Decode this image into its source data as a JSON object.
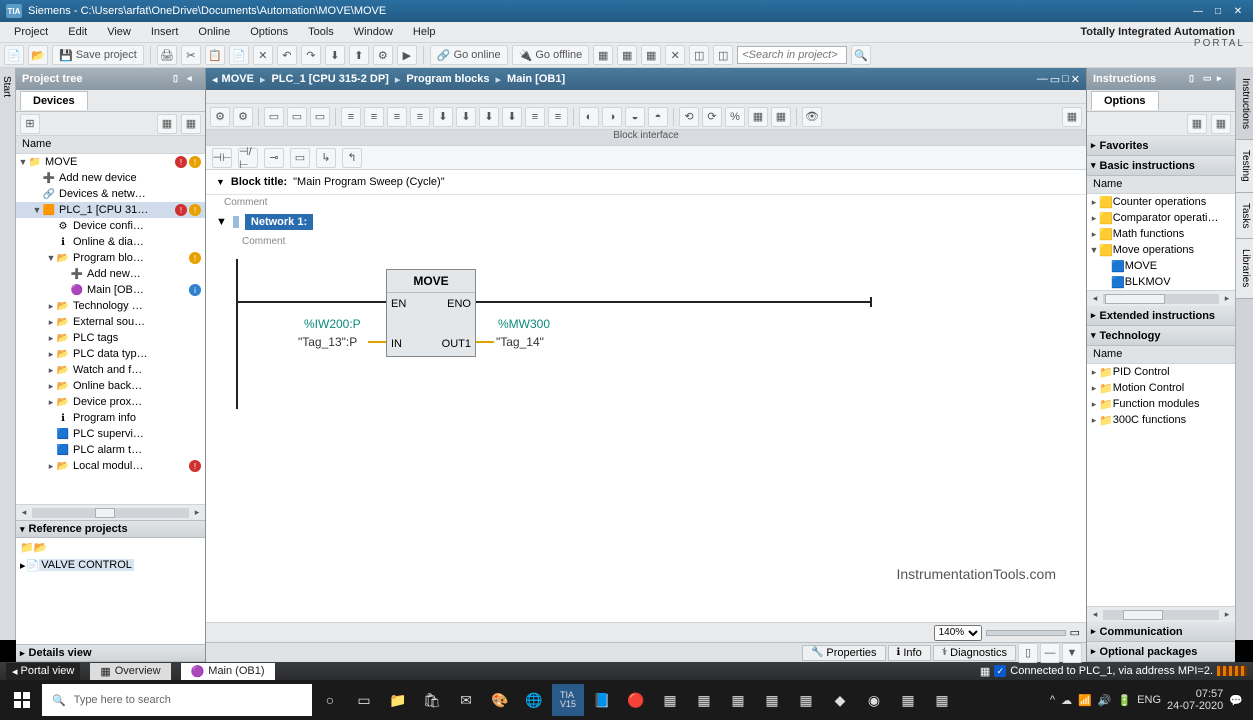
{
  "title": "Siemens  -  C:\\Users\\arfat\\OneDrive\\Documents\\Automation\\MOVE\\MOVE",
  "menu": [
    "Project",
    "Edit",
    "View",
    "Insert",
    "Online",
    "Options",
    "Tools",
    "Window",
    "Help"
  ],
  "brand": {
    "line1": "Totally Integrated Automation",
    "line2": "PORTAL"
  },
  "toolbar1": {
    "save": "Save project",
    "goonline": "Go online",
    "gooffline": "Go offline",
    "search_ph": "<Search in project>"
  },
  "projecttree": {
    "title": "Project tree",
    "tab": "Devices",
    "namehdr": "Name"
  },
  "tree": [
    {
      "ind": 0,
      "exp": "▼",
      "icon": "📁",
      "txt": "MOVE",
      "badges": [
        "err",
        "warn"
      ]
    },
    {
      "ind": 1,
      "exp": "",
      "icon": "➕",
      "txt": "Add new device"
    },
    {
      "ind": 1,
      "exp": "",
      "icon": "🔗",
      "txt": "Devices & netw…"
    },
    {
      "ind": 1,
      "exp": "▼",
      "icon": "🟧",
      "txt": "PLC_1 [CPU 31…",
      "sel": true,
      "badges": [
        "err",
        "warn"
      ]
    },
    {
      "ind": 2,
      "exp": "",
      "icon": "⚙",
      "txt": "Device confi…"
    },
    {
      "ind": 2,
      "exp": "",
      "icon": "ℹ",
      "txt": "Online & dia…"
    },
    {
      "ind": 2,
      "exp": "▼",
      "icon": "📂",
      "txt": "Program blo…",
      "badges": [
        "warn"
      ]
    },
    {
      "ind": 3,
      "exp": "",
      "icon": "➕",
      "txt": "Add new…"
    },
    {
      "ind": 3,
      "exp": "",
      "icon": "🟣",
      "txt": "Main [OB…",
      "badges": [
        "info"
      ]
    },
    {
      "ind": 2,
      "exp": "▸",
      "icon": "📂",
      "txt": "Technology …"
    },
    {
      "ind": 2,
      "exp": "▸",
      "icon": "📂",
      "txt": "External sou…"
    },
    {
      "ind": 2,
      "exp": "▸",
      "icon": "📂",
      "txt": "PLC tags"
    },
    {
      "ind": 2,
      "exp": "▸",
      "icon": "📂",
      "txt": "PLC data typ…"
    },
    {
      "ind": 2,
      "exp": "▸",
      "icon": "📂",
      "txt": "Watch and f…"
    },
    {
      "ind": 2,
      "exp": "▸",
      "icon": "📂",
      "txt": "Online back…"
    },
    {
      "ind": 2,
      "exp": "▸",
      "icon": "📂",
      "txt": "Device prox…"
    },
    {
      "ind": 2,
      "exp": "",
      "icon": "ℹ",
      "txt": "Program info"
    },
    {
      "ind": 2,
      "exp": "",
      "icon": "🟦",
      "txt": "PLC supervi…"
    },
    {
      "ind": 2,
      "exp": "",
      "icon": "🟦",
      "txt": "PLC alarm t…"
    },
    {
      "ind": 2,
      "exp": "▸",
      "icon": "📂",
      "txt": "Local modul…",
      "badges": [
        "err"
      ]
    }
  ],
  "refprojects": {
    "title": "Reference projects",
    "item": "VALVE CONTROL"
  },
  "detailsview": "Details view",
  "breadcrumb": [
    "MOVE",
    "PLC_1 [CPU 315-2 DP]",
    "Program blocks",
    "Main [OB1]"
  ],
  "blockinterface": "Block interface",
  "blocktitle": {
    "lbl": "Block title:",
    "val": "\"Main Program Sweep (Cycle)\"",
    "comment": "Comment"
  },
  "network": {
    "lbl": "Network 1:",
    "comment": "Comment"
  },
  "movebox": {
    "title": "MOVE",
    "en": "EN",
    "eno": "ENO",
    "in": "IN",
    "out1": "OUT1",
    "inaddr": "%IW200:P",
    "intag": "\"Tag_13\":P",
    "outaddr": "%MW300",
    "outtag": "\"Tag_14\""
  },
  "watermark": "InstrumentationTools.com",
  "zoom": "140%",
  "proptabs": {
    "prop": "Properties",
    "info": "Info",
    "diag": "Diagnostics"
  },
  "instructions": {
    "title": "Instructions",
    "options": "Options",
    "fav": "Favorites",
    "basic": "Basic instructions",
    "namehdr": "Name",
    "items": [
      {
        "exp": "▸",
        "icon": "🟨",
        "txt": "Counter operations"
      },
      {
        "exp": "▸",
        "icon": "🟨",
        "txt": "Comparator operati…"
      },
      {
        "exp": "▸",
        "icon": "🟨",
        "txt": "Math functions"
      },
      {
        "exp": "▼",
        "icon": "🟨",
        "txt": "Move operations"
      },
      {
        "exp": "",
        "icon": "🟦",
        "txt": "MOVE",
        "ind": 1
      },
      {
        "exp": "",
        "icon": "🟦",
        "txt": "BLKMOV",
        "ind": 1
      }
    ],
    "ext": "Extended instructions",
    "tech": "Technology",
    "techitems": [
      {
        "exp": "▸",
        "icon": "📁",
        "txt": "PID Control"
      },
      {
        "exp": "▸",
        "icon": "📁",
        "txt": "Motion Control"
      },
      {
        "exp": "▸",
        "icon": "📁",
        "txt": "Function modules"
      },
      {
        "exp": "▸",
        "icon": "📁",
        "txt": "300C functions"
      }
    ],
    "comm": "Communication",
    "optpkg": "Optional packages"
  },
  "sidetabs": [
    "Instructions",
    "Testing",
    "Tasks",
    "Libraries"
  ],
  "lefttab": "Start",
  "statusbar": {
    "portal": "Portal view",
    "overview": "Overview",
    "main": "Main (OB1)",
    "conn": "Connected to PLC_1, via address MPI=2."
  },
  "taskbar": {
    "search_ph": "Type here to search",
    "time": "07:57",
    "date": "24-07-2020",
    "lang": "ENG"
  }
}
